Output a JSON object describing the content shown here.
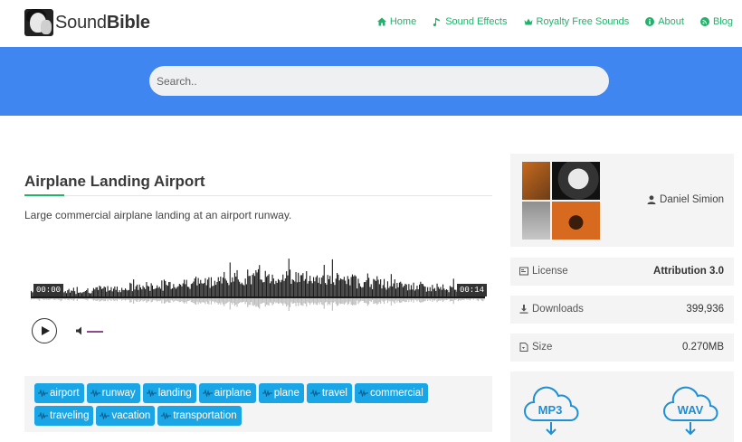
{
  "brand": {
    "name_light": "Sound",
    "name_bold": "Bible"
  },
  "nav": [
    {
      "label": "Home",
      "icon": "home-icon"
    },
    {
      "label": "Sound Effects",
      "icon": "music-note-icon"
    },
    {
      "label": "Royalty Free Sounds",
      "icon": "crown-icon"
    },
    {
      "label": "About",
      "icon": "info-icon"
    },
    {
      "label": "Blog",
      "icon": "blog-icon"
    }
  ],
  "search": {
    "placeholder": "Search.."
  },
  "sound": {
    "title": "Airplane Landing Airport",
    "description": "Large commercial airplane landing at an airport runway.",
    "time_start": "00:00",
    "time_end": "00:14",
    "tags": [
      "airport",
      "runway",
      "landing",
      "airplane",
      "plane",
      "travel",
      "commercial",
      "traveling",
      "vacation",
      "transportation"
    ]
  },
  "sidebar": {
    "author": "Daniel Simion",
    "license_label": "License",
    "license_value": "Attribution 3.0",
    "downloads_label": "Downloads",
    "downloads_value": "399,936",
    "size_label": "Size",
    "size_value": "0.270MB",
    "download_formats": [
      "MP3",
      "WAV"
    ]
  },
  "colors": {
    "accent": "#21b26b",
    "band": "#3f86f0",
    "tag": "#1aa5e6",
    "download": "#1e8fd6"
  }
}
